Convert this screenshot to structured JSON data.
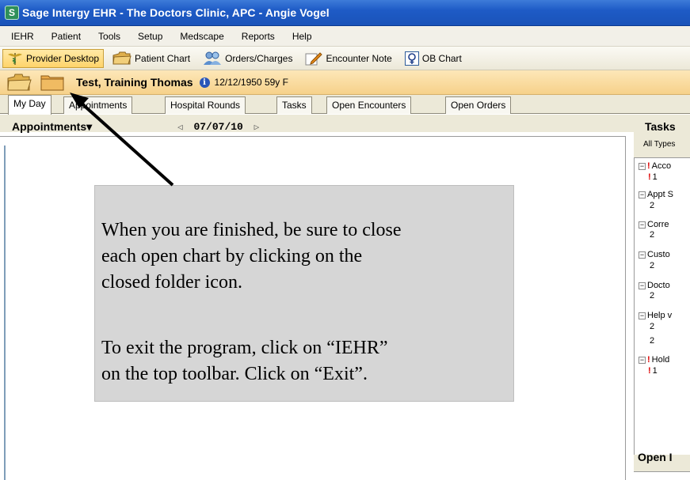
{
  "window": {
    "title": "Sage Intergy EHR - The Doctors Clinic, APC - Angie Vogel",
    "app_icon": "sage-logo-icon"
  },
  "menu": [
    "IEHR",
    "Patient",
    "Tools",
    "Setup",
    "Medscape",
    "Reports",
    "Help"
  ],
  "toolbar": {
    "buttons": [
      {
        "label": "Provider Desktop",
        "icon": "caduceus-icon",
        "active": true
      },
      {
        "label": "Patient Chart",
        "icon": "folder-icon"
      },
      {
        "label": "Orders/Charges",
        "icon": "people-icon"
      },
      {
        "label": "Encounter Note",
        "icon": "pencil-note-icon"
      },
      {
        "label": "OB Chart",
        "icon": "female-symbol-icon"
      }
    ]
  },
  "patient": {
    "name": "Test, Training Thomas",
    "dob_age": "12/12/1950 59y F",
    "info_icon": "info-icon"
  },
  "tabs": [
    "My Day",
    "Appointments",
    "Hospital Rounds",
    "Tasks",
    "Open Encounters",
    "Open Orders"
  ],
  "appointments": {
    "title": "Appointments",
    "dropdown_glyph": "▾",
    "date": "07/07/10",
    "prev": "◁",
    "next": "▷"
  },
  "tasks": {
    "title": "Tasks",
    "filter": "All Types",
    "groups": [
      {
        "label": "Acco",
        "urgent": true,
        "count": "1",
        "count_urgent": true
      },
      {
        "label": "Appt S",
        "urgent": false,
        "count": "2"
      },
      {
        "label": "Corre",
        "urgent": false,
        "count": "2"
      },
      {
        "label": "Custo",
        "urgent": false,
        "count": "2"
      },
      {
        "label": "Docto",
        "urgent": false,
        "count": "2"
      },
      {
        "label": "Help v",
        "urgent": false,
        "count": "2",
        "count2": "2"
      },
      {
        "label": "Hold",
        "urgent": true,
        "count": "1",
        "count_urgent": true
      }
    ],
    "expander_glyph": "⊟",
    "urgent_glyph": "!"
  },
  "open_section": {
    "title": "Open I"
  },
  "callout": {
    "line1": "When you are finished, be sure to close",
    "line2": "each open chart by clicking on the",
    "line3": "closed folder icon.",
    "line4": "To exit the program, click on “IEHR”",
    "line5": "on the top toolbar. Click on “Exit”."
  },
  "colors": {
    "titlebar": "#1e5bc6",
    "patientbar": "#f6d18a",
    "urgent": "#dd0000",
    "callout_bg": "#d6d6d6"
  }
}
